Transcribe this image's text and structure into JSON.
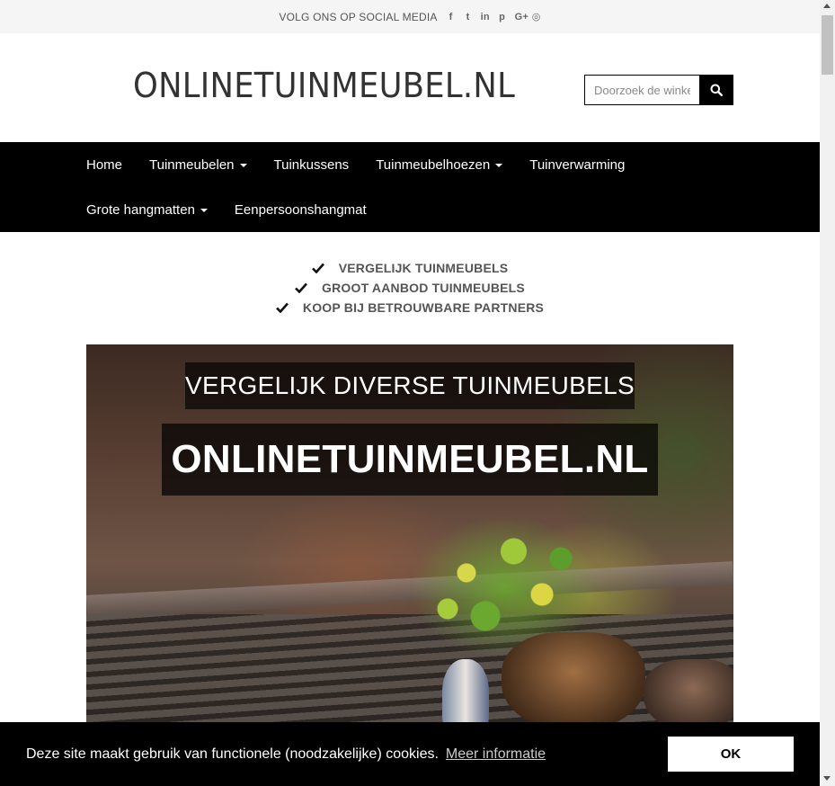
{
  "topbar": {
    "label": "VOLG ONS OP SOCIAL MEDIA",
    "social": [
      {
        "icon": "facebook-icon",
        "glyph": "f"
      },
      {
        "icon": "twitter-icon",
        "glyph": "t"
      },
      {
        "icon": "linkedin-icon",
        "glyph": "in"
      },
      {
        "icon": "pinterest-icon",
        "glyph": "p"
      },
      {
        "icon": "google-plus-icon",
        "glyph": "G+"
      },
      {
        "icon": "instagram-icon",
        "glyph": "◎"
      }
    ]
  },
  "header": {
    "logo": "ONLINETUINMEUBEL.NL",
    "search_placeholder": "Doorzoek de winkel",
    "search_icon": "search-icon"
  },
  "nav": {
    "rows": [
      [
        {
          "label": "Home",
          "dropdown": false
        },
        {
          "label": "Tuinmeubelen",
          "dropdown": true
        },
        {
          "label": "Tuinkussens",
          "dropdown": false
        },
        {
          "label": "Tuinmeubelhoezen",
          "dropdown": true
        },
        {
          "label": "Tuinverwarming",
          "dropdown": false
        }
      ],
      [
        {
          "label": "Grote hangmatten",
          "dropdown": true
        },
        {
          "label": "Eenpersoonshangmat",
          "dropdown": false
        }
      ]
    ]
  },
  "usps": [
    "VERGELIJK TUINMEUBELS",
    "GROOT AANBOD TUINMEUBELS",
    "KOOP BIJ BETROUWBARE PARTNERS"
  ],
  "hero": {
    "subtitle": "VERGELIJK DIVERSE TUINMEUBELS",
    "title": "ONLINETUINMEUBEL.NL"
  },
  "cookie": {
    "text": "Deze site maakt gebruik van functionele (noodzakelijke) cookies.",
    "link": "Meer informatie",
    "button": "OK"
  },
  "colors": {
    "nav_bg": "#000000",
    "topbar_bg": "#f5f5f5",
    "text_dark": "#333333"
  }
}
